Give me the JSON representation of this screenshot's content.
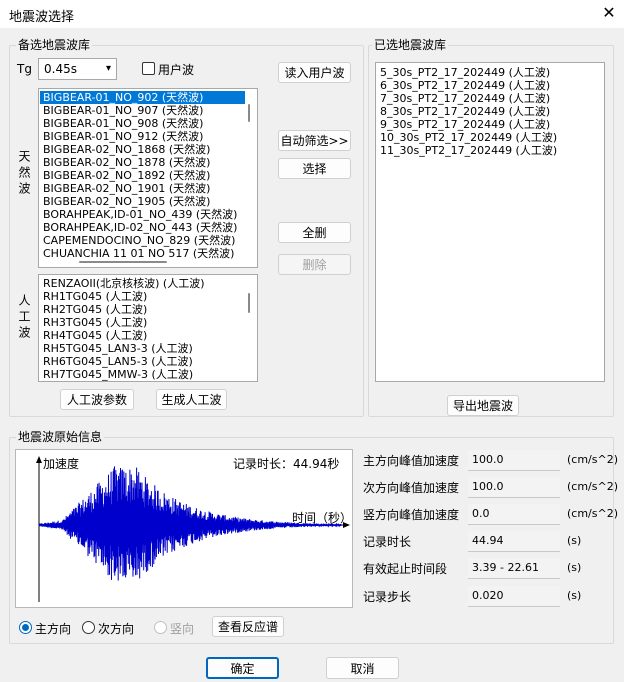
{
  "window": {
    "title": "地震波选择",
    "close_glyph": "✕"
  },
  "candidate_library": {
    "group_label": "备选地震波库",
    "tg_label": "Tg",
    "tg_value": "0.45s",
    "user_wave_checkbox_label": "用户波",
    "user_wave_checked": false,
    "natural_label": "天然波",
    "natural_items": [
      "BIGBEAR-01_NO_902 (天然波)",
      "BIGBEAR-01_NO_907 (天然波)",
      "BIGBEAR-01_NO_908 (天然波)",
      "BIGBEAR-01_NO_912 (天然波)",
      "BIGBEAR-02_NO_1868 (天然波)",
      "BIGBEAR-02_NO_1878 (天然波)",
      "BIGBEAR-02_NO_1892 (天然波)",
      "BIGBEAR-02_NO_1901 (天然波)",
      "BIGBEAR-02_NO_1905 (天然波)",
      "BORAHPEAK,ID-01_NO_439 (天然波)",
      "BORAHPEAK,ID-02_NO_443 (天然波)",
      "CAPEMENDOCINO_NO_829 (天然波)",
      "CHUANCHIA 11 01 NO 517 (天然波)"
    ],
    "artificial_label": "人工波",
    "artificial_items": [
      "RENZAOII(北京核核波) (人工波)",
      "RH1TG045 (人工波)",
      "RH2TG045 (人工波)",
      "RH3TG045 (人工波)",
      "RH4TG045 (人工波)",
      "RH5TG045_LAN3-3 (人工波)",
      "RH6TG045_LAN5-3 (人工波)",
      "RH7TG045_MMW-3 (人工波)"
    ],
    "artificial_params_button": "人工波参数",
    "generate_artificial_button": "生成人工波"
  },
  "middle_buttons": {
    "read_user_wave": "读入用户波",
    "auto_filter": "自动筛选>>",
    "select": "选择",
    "clear_all": "全删",
    "delete": "删除"
  },
  "selected_library": {
    "group_label": "已选地震波库",
    "items": [
      "5_30s_PT2_17_202449 (人工波)",
      "6_30s_PT2_17_202449 (人工波)",
      "7_30s_PT2_17_202449 (人工波)",
      "8_30s_PT2_17_202449 (人工波)",
      "9_30s_PT2_17_202449 (人工波)",
      "10_30s_PT2_17_202449 (人工波)",
      "11_30s_PT2_17_202449 (人工波)"
    ],
    "export_button": "导出地震波"
  },
  "original_info": {
    "group_label": "地震波原始信息",
    "chart_y_label": "加速度",
    "chart_duration_label": "记录时长：44.94秒",
    "chart_x_label": "时间（秒）",
    "properties": [
      {
        "label": "主方向峰值加速度",
        "value": "100.0",
        "unit": "(cm/s^2)"
      },
      {
        "label": "次方向峰值加速度",
        "value": "100.0",
        "unit": "(cm/s^2)"
      },
      {
        "label": "竖方向峰值加速度",
        "value": "0.0",
        "unit": "(cm/s^2)"
      },
      {
        "label": "记录时长",
        "value": "44.94",
        "unit": "(s)"
      },
      {
        "label": "有效起止时间段",
        "value": "3.39 - 22.61",
        "unit": "(s)"
      },
      {
        "label": "记录步长",
        "value": "0.020",
        "unit": "(s)"
      }
    ],
    "radio_main": "主方向",
    "radio_secondary": "次方向",
    "radio_vertical": "竖向",
    "response_spectrum_button": "查看反应谱",
    "wave_color": "#0000cc"
  },
  "footer": {
    "ok": "确定",
    "cancel": "取消"
  }
}
